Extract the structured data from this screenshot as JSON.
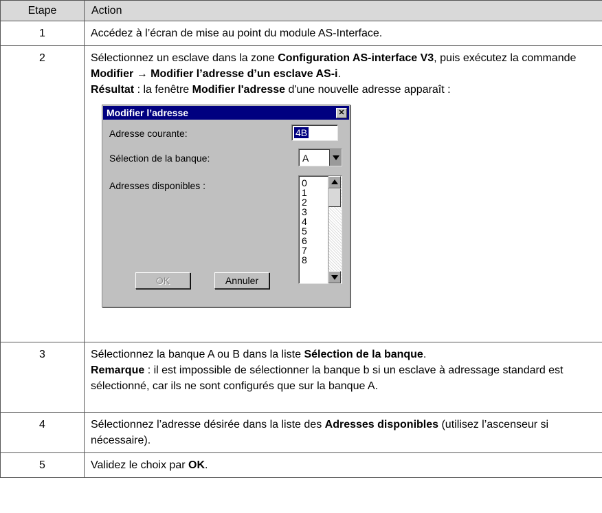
{
  "header": {
    "col_step": "Etape",
    "col_action": "Action"
  },
  "rows": {
    "r1": {
      "num": "1",
      "text": "Accédez à l’écran de mise au point du module AS-Interface."
    },
    "r2": {
      "num": "2",
      "p1_a": "Sélectionnez un esclave dans la zone ",
      "p1_b": "Configuration AS-interface V3",
      "p1_c": ", puis exécutez la commande ",
      "p1_d": "Modifier → Modifier l’adresse d’un esclave AS-i",
      "p1_e": ".",
      "p2_a": "Résultat",
      "p2_b": " : la fenêtre ",
      "p2_c": "Modifier l'adresse",
      "p2_d": " d'une nouvelle adresse apparaît :"
    },
    "r3": {
      "num": "3",
      "p1_a": "Sélectionnez la banque A ou B dans la liste ",
      "p1_b": "Sélection de la banque",
      "p1_c": ".",
      "p2_a": "Remarque",
      "p2_b": " : il est impossible de sélectionner la banque b si un esclave à adressage standard est sélectionné, car ils ne sont configurés que sur la banque A."
    },
    "r4": {
      "num": "4",
      "p_a": "Sélectionnez l’adresse désirée dans la liste des ",
      "p_b": "Adresses disponibles",
      "p_c": " (utilisez l’ascenseur si nécessaire)."
    },
    "r5": {
      "num": "5",
      "p_a": "Validez le choix par ",
      "p_b": "OK",
      "p_c": "."
    }
  },
  "dialog": {
    "title": "Modifier l’adresse",
    "close_icon": "close-x-icon",
    "current_label": "Adresse courante:",
    "current_value": "4B",
    "bank_label": "Sélection de la banque:",
    "bank_value": "A",
    "available_label": "Adresses disponibles :",
    "available_items": [
      "0",
      "1",
      "2",
      "3",
      "4",
      "5",
      "6",
      "7",
      "8"
    ],
    "ok_label": "OK",
    "cancel_label": "Annuler"
  },
  "colors": {
    "title_bar": "#000080",
    "header_bg": "#d9d9d9",
    "dialog_bg": "#c0c0c0"
  }
}
